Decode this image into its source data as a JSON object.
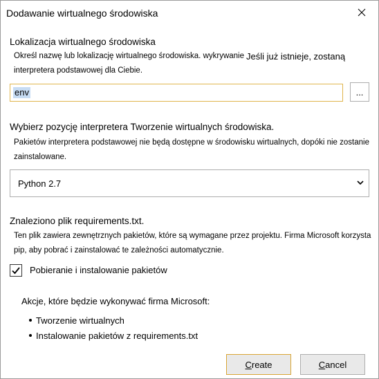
{
  "dialog": {
    "title": "Dodawanie wirtualnego środowiska"
  },
  "location": {
    "heading": "Lokalizacja wirtualnego środowiska",
    "desc_line1": "Określ nazwę lub lokalizację wirtualnego środowiska. wykrywanie",
    "desc_aside": "Jeśli już istnieje, zostaną",
    "desc_line2": "interpretera podstawowej dla Ciebie.",
    "input_value": "env",
    "browse_label": "..."
  },
  "interpreter": {
    "heading": "Wybierz pozycję interpretera Tworzenie wirtualnych środowiska.",
    "desc_line1": "Pakietów interpretera podstawowej nie będą dostępne w środowisku wirtualnych, dopóki nie zostanie",
    "desc_line2": "zainstalowane.",
    "selected": "Python 2.7"
  },
  "requirements": {
    "heading": "Znaleziono plik requirements.txt.",
    "desc_line1": "Ten plik zawiera zewnętrznych pakietów, które są wymagane przez projektu. Firma Microsoft korzysta",
    "desc_line2": "pip, aby pobrać i zainstalować te zależności automatycznie.",
    "checkbox_label": "Pobieranie i instalowanie pakietów",
    "checkbox_checked": true
  },
  "actions": {
    "heading": "Akcje, które będzie wykonywać firma Microsoft:",
    "items": [
      "Tworzenie wirtualnych",
      "Instalowanie pakietów z requirements.txt"
    ]
  },
  "buttons": {
    "create": "Create",
    "cancel": "Cancel"
  },
  "colors": {
    "focus_border": "#e0b44a",
    "selection": "#c7dcf3"
  },
  "icons": {
    "close": "close-icon",
    "dropdown": "chevron-down-icon",
    "check": "check-icon"
  }
}
